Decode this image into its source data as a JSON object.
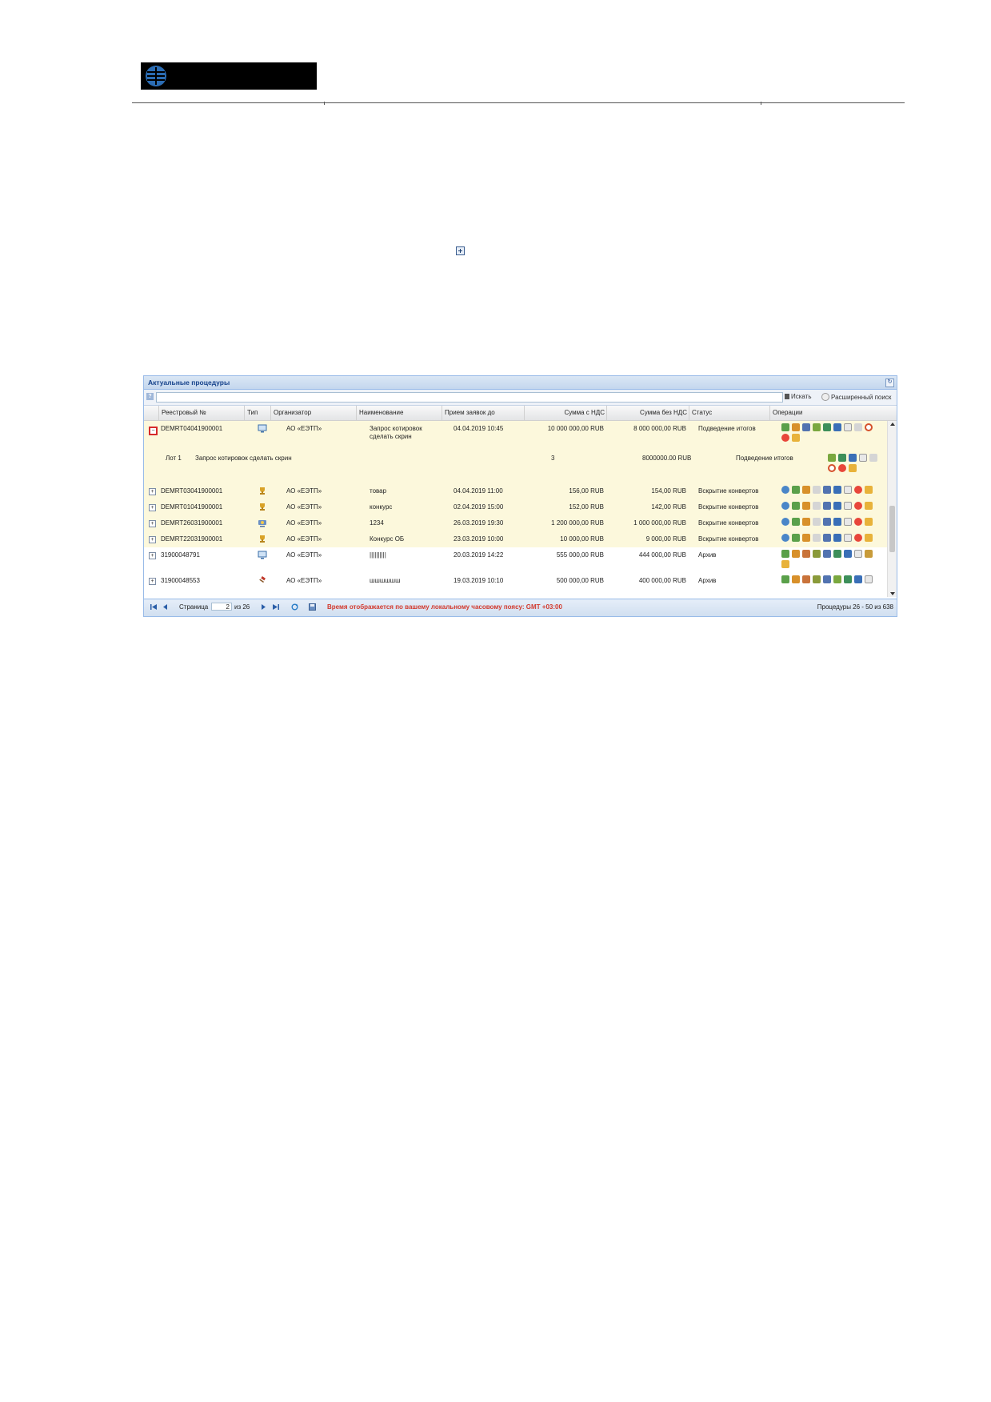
{
  "panel": {
    "title": "Актуальные процедуры",
    "search_label": "Искать",
    "advanced_search_label": "Расширенный поиск",
    "help_label": "?"
  },
  "columns": {
    "reg_no": "Реестровый №",
    "type": "Тип",
    "organizer": "Организатор",
    "name": "Наименование",
    "deadline": "Прием заявок до",
    "sum_vat": "Сумма с НДС",
    "sum_novat": "Сумма без НДС",
    "status": "Статус",
    "ops": "Операции"
  },
  "rows": [
    {
      "reg_no": "DEMRT04041900001",
      "type_icon": "monitor-icon",
      "organizer": "АО «ЕЭТП»",
      "name_line1": "Запрос котировок",
      "name_line2": "сделать скрин",
      "deadline": "04.04.2019 10:45",
      "sum_vat": "10 000 000,00 RUB",
      "sum_novat": "8 000 000,00 RUB",
      "status": "Подведение итогов"
    },
    {
      "reg_no": "DEMRT03041900001",
      "type_icon": "trophy-icon",
      "organizer": "АО «ЕЭТП»",
      "name_line1": "товар",
      "name_line2": "",
      "deadline": "04.04.2019 11:00",
      "sum_vat": "156,00 RUB",
      "sum_novat": "154,00 RUB",
      "status": "Вскрытие конвертов"
    },
    {
      "reg_no": "DEMRT01041900001",
      "type_icon": "trophy-icon",
      "organizer": "АО «ЕЭТП»",
      "name_line1": "конкурс",
      "name_line2": "",
      "deadline": "02.04.2019 15:00",
      "sum_vat": "152,00 RUB",
      "sum_novat": "142,00 RUB",
      "status": "Вскрытие конвертов"
    },
    {
      "reg_no": "DEMRT26031900001",
      "type_icon": "auction-icon",
      "organizer": "АО «ЕЭТП»",
      "name_line1": "1234",
      "name_line2": "",
      "deadline": "26.03.2019 19:30",
      "sum_vat": "1 200 000,00 RUB",
      "sum_novat": "1 000 000,00 RUB",
      "status": "Вскрытие конвертов"
    },
    {
      "reg_no": "DEMRT22031900001",
      "type_icon": "trophy-icon",
      "organizer": "АО «ЕЭТП»",
      "name_line1": "Конкурс ОБ",
      "name_line2": "",
      "deadline": "23.03.2019 10:00",
      "sum_vat": "10 000,00 RUB",
      "sum_novat": "9 000,00 RUB",
      "status": "Вскрытие конвертов"
    },
    {
      "reg_no": "31900048791",
      "type_icon": "monitor-icon",
      "organizer": "АО «ЕЭТП»",
      "name_line1": "||||||||||",
      "name_line2": "",
      "deadline": "20.03.2019 14:22",
      "sum_vat": "555 000,00 RUB",
      "sum_novat": "444 000,00 RUB",
      "status": "Архив"
    },
    {
      "reg_no": "31900048553",
      "type_icon": "hammer-icon",
      "organizer": "АО «ЕЭТП»",
      "name_line1": "шшшшшш",
      "name_line2": "",
      "deadline": "19.03.2019 10:10",
      "sum_vat": "500 000,00 RUB",
      "sum_novat": "400 000,00 RUB",
      "status": "Архив"
    }
  ],
  "lot": {
    "label": "Лот 1",
    "name": "Запрос котировок сделать скрин",
    "qty": "3",
    "sum": "8000000.00 RUB",
    "status": "Подведение итогов"
  },
  "pager": {
    "page_label": "Страница",
    "page_value": "2",
    "of_label": "из 26",
    "tz_notice": "Время отображается по вашему локальному часовому поясу: GMT +03:00",
    "total": "Процедуры 26 - 50 из 638"
  },
  "colors": {
    "accent": "#15428b",
    "row_highlight": "#fcf8dc",
    "notice": "#d23a2e"
  }
}
